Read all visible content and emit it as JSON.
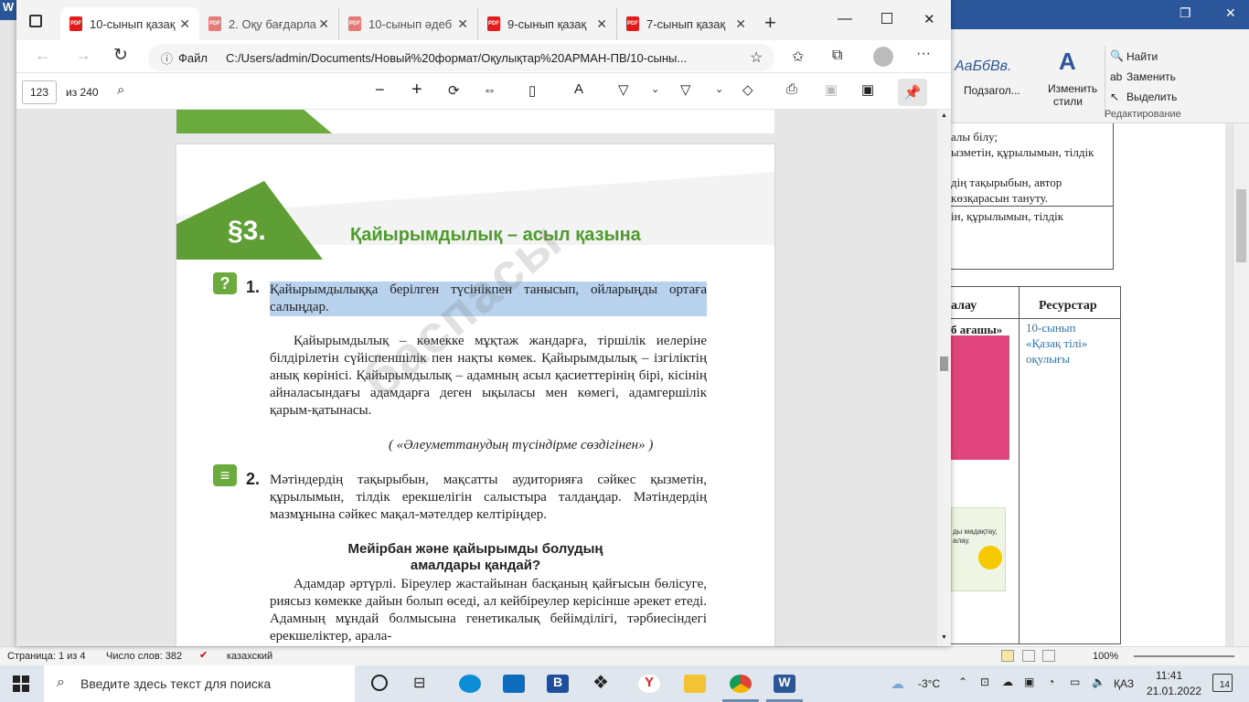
{
  "word": {
    "title_glyph": "W",
    "ribbon": {
      "style_preview": "АаБбВв.",
      "style_name": "Подзагол...",
      "change_styles": "Изменить",
      "change_styles2": "стили",
      "find": "Найти",
      "replace": "Заменить",
      "select": "Выделить",
      "group_editing": "Редактирование"
    },
    "doc_lines": [
      "алы білу;",
      "ызметін, құрылымын, тілдік",
      "дің тақырыбын, автор",
      "көзқарасын тануту.",
      "ін, құрылымын, тілдік",
      "алау",
      "Ресурстар",
      "б ағашы»",
      "10-сынып",
      "«Қазақ тілі»",
      "оқулығы",
      "ды мадақтау,",
      "алау."
    ],
    "status": {
      "page": "Страница: 1 из 4",
      "words": "Число слов: 382",
      "lang": "казахский",
      "zoom": "100%"
    }
  },
  "edge": {
    "tabs": [
      {
        "label": "10-сынып қазақ"
      },
      {
        "label": "2. Оқу бағдарла"
      },
      {
        "label": "10-сынып әдеб"
      },
      {
        "label": "9-сынып қазақ"
      },
      {
        "label": "7-сынып қазақ"
      }
    ],
    "pdf_badge": "PDF",
    "address_label": "Файл",
    "address": "C:/Users/admin/Documents/Новый%20формат/Оқулықтар%20АРМАН-ПВ/10-сыны...",
    "page_num": "123",
    "page_total": "из 240"
  },
  "pdf": {
    "section": "§3.",
    "title": "Қайырымдылық – асыл қазына",
    "task1_num": "1.",
    "task1_text": "Қайырымдылыққа берілген түсінікпен танысып, ойларыңды ортаға салыңдар.",
    "def_text": "Қайырымдылық – көмекке мұқтаж жандарға, тіршілік иелеріне білдірілетін сүйіспеншілік пен нақты көмек. Қайырымдылық – ізгіліктің анық көрінісі. Қайырымдылық – адамның асыл қасиеттерінің бірі, кісінің айналасындағы адамдарға деген ықыласы мен көмегі, адамгершілік қарым-қатынасы.",
    "def_source": "( «Әлеуметтанудың түсіндірме сөздігінен» )",
    "task2_num": "2.",
    "task2_text": "Мәтіндердің тақырыбын, мақсатты аудиторияға сәйкес қызметін, құрылымын, тілдік ерекшелігін салыстыра талдаңдар. Мәтіндердің мазмұнына сәйкес мақал-мәтелдер келтіріңдер.",
    "subtitle1": "Мейірбан және қайырымды болудың",
    "subtitle2": "амалдары қандай?",
    "body": "Адамдар әртүрлі. Біреулер жастайынан басқаның қайғысын бөлісуге, риясыз көмекке дайын болып өседі, ал кейбіреулер керісінше әрекет етеді. Адамның мұндай болмысына генетикалық бейімділігі, тәрбиесіндегі ерекшеліктер, арала-",
    "watermark": "баспасы"
  },
  "taskbar": {
    "search_placeholder": "Введите здесь текст для поиска",
    "weather": "-3°C",
    "lang": "ҚАЗ",
    "time": "11:41",
    "date": "21.01.2022",
    "notif": "14"
  }
}
